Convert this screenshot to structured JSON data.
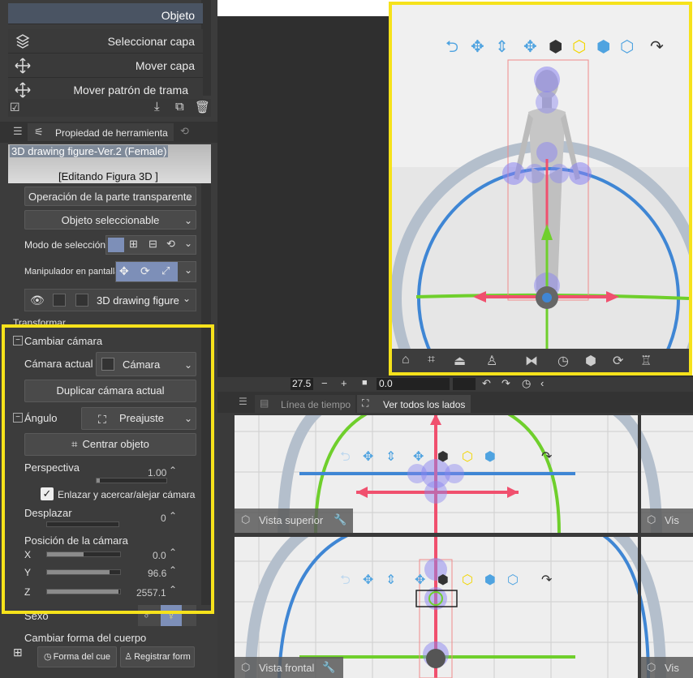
{
  "tools": {
    "objeto": "Objeto",
    "seleccionar_capa": "Seleccionar capa",
    "mover_capa": "Mover capa",
    "mover_patron": "Mover patrón de trama"
  },
  "tool_property": {
    "title": "Propiedad de herramienta",
    "figure_name": "3D drawing figure-Ver.2 (Female)",
    "editing": "[Editando Figura 3D ]",
    "transparent_op": "Operación de la parte transparente",
    "selectable_object": "Objeto seleccionable",
    "selection_mode": "Modo de selección",
    "manipulator": "Manipulador en pantalla",
    "layer_name": "3D drawing figure",
    "transformar": "Transformar"
  },
  "camera": {
    "section": "Cambiar cámara",
    "current_label": "Cámara actual",
    "current_value": "Cámara",
    "duplicate": "Duplicar cámara actual"
  },
  "angle": {
    "section": "Ángulo",
    "preset": "Preajuste",
    "center": "Centrar objeto",
    "perspective_label": "Perspectiva",
    "perspective_value": "1.00",
    "perspective_level": 0.05,
    "link_zoom": "Enlazar y acercar/alejar cámara",
    "pan_label": "Desplazar",
    "pan_value": "0",
    "position_label": "Posición de la cámara",
    "x_label": "X",
    "x_value": "0.0",
    "x_level": 0.5,
    "y_label": "Y",
    "y_value": "96.6",
    "y_level": 0.85,
    "z_label": "Z",
    "z_value": "2557.1",
    "z_level": 0.98
  },
  "body": {
    "sexo": "Sexo",
    "change_shape": "Cambiar forma del cuerpo",
    "body_shape_btn": "Forma del cue",
    "register_btn": "Registrar form"
  },
  "timeline": {
    "frame_value": "27.5",
    "zero_value": "0.0",
    "tab_timeline": "Línea de tiempo",
    "tab_allsides": "Ver todos los lados"
  },
  "views": {
    "top": "Vista superior",
    "front": "Vista frontal",
    "top_right_cut": "Vis",
    "front_right_cut": "Vis"
  },
  "colors": {
    "panel_bg": "#3c3c3c",
    "highlight": "#f6e21b",
    "axis_red": "#f0506e",
    "axis_green": "#6fcf2c",
    "axis_blue": "#3f86d4",
    "joint": "#8a84f0",
    "ring_gray": "#b4bfcc",
    "icon_blue": "#4fa3e0",
    "icon_yellow": "#f2d600"
  }
}
